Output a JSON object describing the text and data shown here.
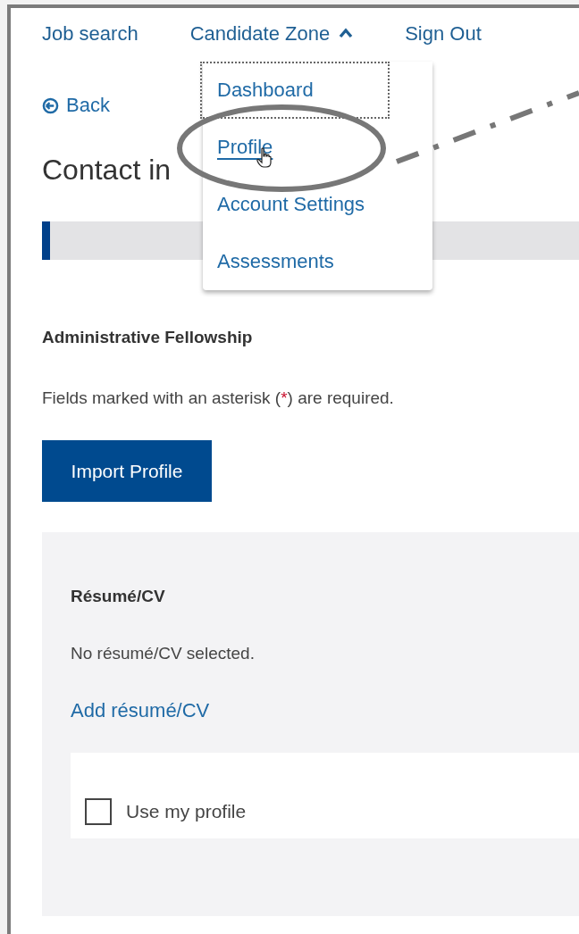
{
  "nav": {
    "items": [
      {
        "label": "Job search",
        "kind": "link"
      },
      {
        "label": "Candidate Zone",
        "kind": "menu",
        "expanded": true
      },
      {
        "label": "Sign Out",
        "kind": "link"
      }
    ]
  },
  "menu": {
    "items": [
      {
        "label": "Dashboard",
        "focused": true,
        "hovered": false
      },
      {
        "label": "Profile",
        "focused": false,
        "hovered": true
      },
      {
        "label": "Account Settings",
        "focused": false,
        "hovered": false
      },
      {
        "label": "Assessments",
        "focused": false,
        "hovered": false
      }
    ]
  },
  "back": "Back",
  "heading": "Contact in",
  "progress": {
    "level": 0.015
  },
  "job_title": "Administrative Fellowship",
  "required_note": {
    "before": "Fields marked with an asterisk (",
    "asterisk": "*",
    "after": ") are required."
  },
  "import_button": "Import Profile",
  "resume": {
    "title": "Résumé/CV",
    "status": "No résumé/CV selected.",
    "add_link": "Add résumé/CV",
    "use_profile": {
      "label": "Use my profile",
      "checked": false
    }
  }
}
